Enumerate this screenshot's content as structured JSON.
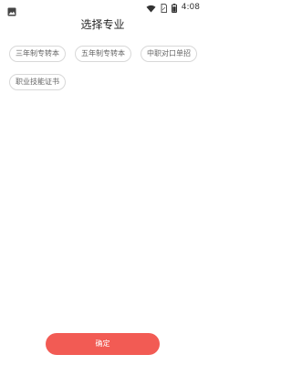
{
  "status_bar": {
    "time": "4:08",
    "icons": [
      "image-icon",
      "wifi-icon",
      "sim-icon",
      "battery-icon"
    ]
  },
  "page": {
    "title": "选择专业"
  },
  "tags": [
    {
      "label": "三年制专转本"
    },
    {
      "label": "五年制专转本"
    },
    {
      "label": "中职对口单招"
    },
    {
      "label": "职业技能证书"
    }
  ],
  "confirm": {
    "label": "确定"
  },
  "colors": {
    "accent": "#f25b54",
    "tag_border": "#d8d8d8",
    "tag_text": "#666666",
    "background": "#ffffff"
  }
}
